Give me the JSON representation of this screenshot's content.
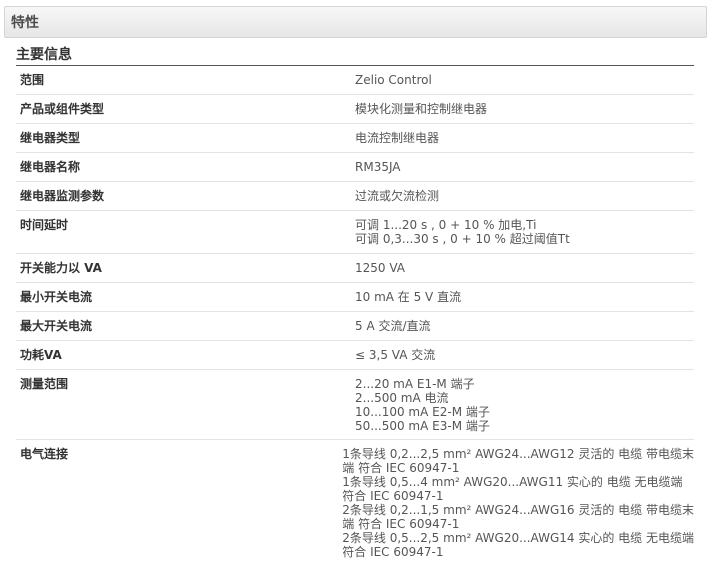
{
  "header": {
    "title": "特性"
  },
  "section": {
    "title": "主要信息",
    "rows": [
      {
        "label": "范围",
        "values": [
          "Zelio Control"
        ]
      },
      {
        "label": "产品或组件类型",
        "values": [
          "模块化测量和控制继电器"
        ]
      },
      {
        "label": "继电器类型",
        "values": [
          "电流控制继电器"
        ]
      },
      {
        "label": "继电器名称",
        "values": [
          "RM35JA"
        ]
      },
      {
        "label": "继电器监测参数",
        "values": [
          "过流或欠流检测"
        ]
      },
      {
        "label": "时间延时",
        "values": [
          "可调 1...20 s , 0 + 10 % 加电,Ti",
          "可调 0,3...30 s , 0 + 10 % 超过阈值Tt"
        ]
      },
      {
        "label": "开关能力以 VA",
        "values": [
          "1250 VA"
        ]
      },
      {
        "label": "最小开关电流",
        "values": [
          "10 mA 在 5 V 直流"
        ]
      },
      {
        "label": "最大开关电流",
        "values": [
          "5 A 交流/直流"
        ]
      },
      {
        "label": "功耗VA",
        "values": [
          "≤ 3,5 VA 交流"
        ]
      },
      {
        "label": "测量范围",
        "values": [
          "2...20 mA E1-M 端子",
          "2...500 mA 电流",
          "10...100 mA E2-M 端子",
          "50...500 mA E3-M 端子"
        ]
      },
      {
        "label": "电气连接",
        "values": [
          "1条导线 0,2...2,5 mm² AWG24...AWG12 灵活的 电缆 带电缆末",
          "端 符合 IEC 60947-1",
          "1条导线 0,5...4 mm² AWG20...AWG11 实心的 电缆 无电缆端",
          "符合 IEC 60947-1",
          "2条导线 0,2...1,5 mm² AWG24...AWG16 灵活的 电缆 带电缆末",
          "端 符合 IEC 60947-1",
          "2条导线 0,5...2,5 mm² AWG20...AWG14 实心的 电缆 无电缆端",
          "符合 IEC 60947-1"
        ]
      }
    ]
  }
}
